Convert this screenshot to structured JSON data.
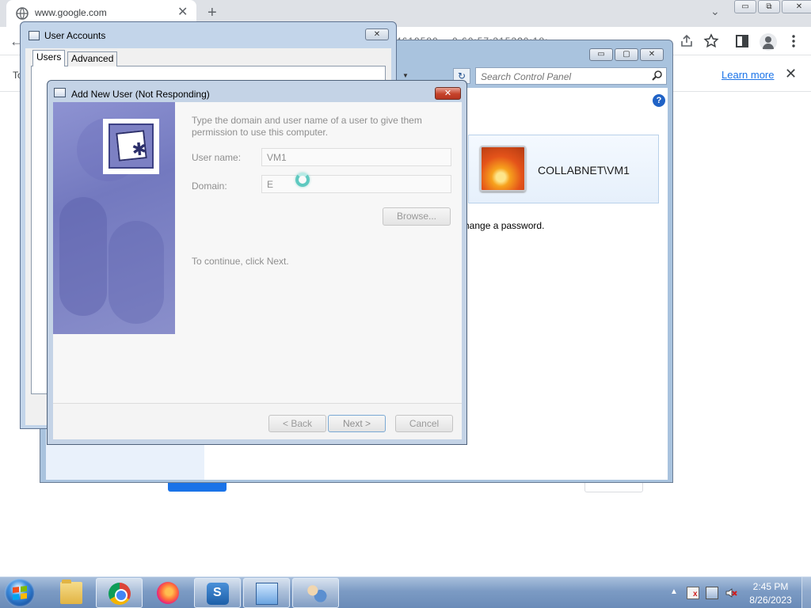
{
  "chrome": {
    "tab_title": "www.google.com",
    "tab_close_glyph": "✕",
    "new_tab_glyph": "+",
    "tab_search_glyph": "⌄",
    "window_min_glyph": "▭",
    "window_restore_glyph": "⧉",
    "window_close_glyph": "✕",
    "address_fragment": "4619580…              0                         60:57:3153?0:18:",
    "infobar_prefix": "To",
    "learn_more": "Learn more",
    "infobar_close_glyph": "✕",
    "back_glyph": "←",
    "icons": [
      "share-icon",
      "star-icon",
      "side-panel-icon",
      "profile-icon",
      "menu-icon"
    ]
  },
  "control_panel": {
    "search_placeholder": "Search Control Panel",
    "help_glyph": "?",
    "user_name": "COLLABNET\\VM1",
    "text_fragment": "hange a password.",
    "refresh_glyph": "↻",
    "dropdown_glyph": "▼",
    "window_min_glyph": "▭",
    "window_max_glyph": "▢",
    "window_close_glyph": "✕"
  },
  "user_accounts": {
    "title": "User Accounts",
    "close_glyph": "✕",
    "tabs": [
      {
        "label": "Users"
      },
      {
        "label": "Advanced"
      }
    ]
  },
  "add_new_user": {
    "title": "Add New User (Not Responding)",
    "close_glyph": "✕",
    "intro": "Type the domain and user name of a user to give them permission to use this computer.",
    "username_label": "User name:",
    "username_value": "VM1",
    "domain_label": "Domain:",
    "domain_value": "E",
    "browse_label": "Browse...",
    "continue_text": "To continue, click Next.",
    "back_label": "< Back",
    "next_label": "Next >",
    "cancel_label": "Cancel",
    "key_glyph": "✱"
  },
  "taskbar": {
    "apps": [
      "folder-icon",
      "chrome-icon",
      "firefox-icon",
      "security-shield-icon",
      "control-panel-icon",
      "user-accounts-icon"
    ],
    "tray_arrow": "▲",
    "time": "2:45 PM",
    "date": "8/26/2023"
  }
}
